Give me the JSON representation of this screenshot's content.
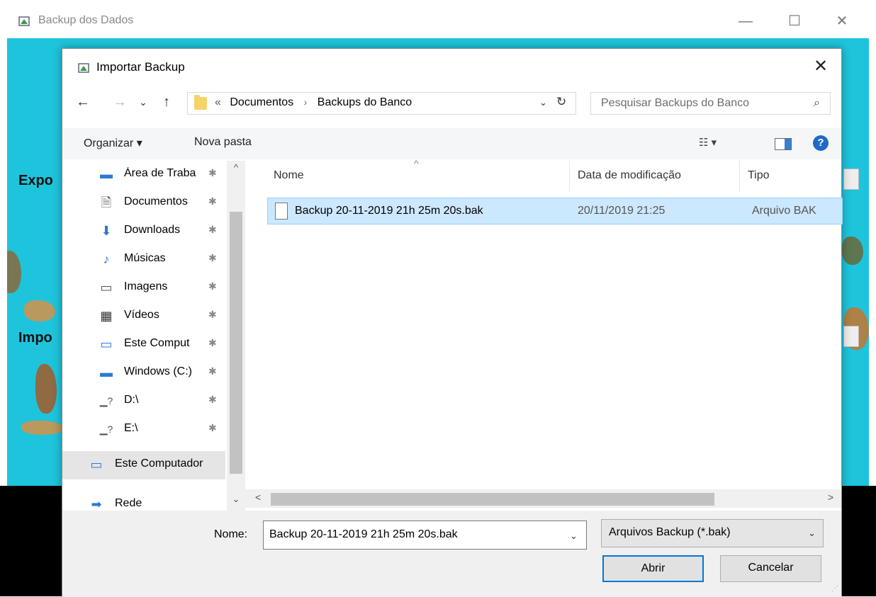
{
  "app": {
    "title": "Backup dos Dados",
    "side_labels": [
      "Expo",
      "Impo"
    ],
    "controls": {
      "minimize": "—",
      "maximize": "☐",
      "close": "✕"
    }
  },
  "dialog": {
    "title": "Importar Backup",
    "close": "✕",
    "nav": {
      "back": "←",
      "forward": "→",
      "recent": "⌄",
      "up": "↑"
    },
    "address": {
      "overflow": "«",
      "crumbs": [
        "Documentos",
        "Backups do Banco"
      ],
      "separator": "›",
      "dropdown": "⌄",
      "refresh": "↻"
    },
    "search": {
      "placeholder": "Pesquisar Backups do Banco",
      "icon": "⌕"
    },
    "toolbar": {
      "organize": "Organizar ▾",
      "new_folder": "Nova pasta",
      "view_icon": "☷ ▾",
      "help": "?"
    },
    "nav_pane": {
      "items": [
        {
          "label": "Área de Traba",
          "icon": "desktop-icon",
          "glyph": "▬",
          "color": "#2b7bd3",
          "pinned": true
        },
        {
          "label": "Documentos",
          "icon": "document-icon",
          "glyph": "🗎",
          "color": "#555555",
          "pinned": true
        },
        {
          "label": "Downloads",
          "icon": "download-icon",
          "glyph": "⬇",
          "color": "#2b7bd3",
          "pinned": true
        },
        {
          "label": "Músicas",
          "icon": "music-icon",
          "glyph": "♪",
          "color": "#2b7bd3",
          "pinned": true
        },
        {
          "label": "Imagens",
          "icon": "pictures-icon",
          "glyph": "▭",
          "color": "#555555",
          "pinned": true
        },
        {
          "label": "Vídeos",
          "icon": "video-icon",
          "glyph": "▦",
          "color": "#333333",
          "pinned": true
        },
        {
          "label": "Este Comput",
          "icon": "computer-icon",
          "glyph": "▭",
          "color": "#2b7bd3",
          "pinned": true
        },
        {
          "label": "Windows (C:)",
          "icon": "drive-icon",
          "glyph": "▬",
          "color": "#2b7bd3",
          "pinned": true
        },
        {
          "label": "D:\\",
          "icon": "drive-icon",
          "glyph": "▁?",
          "color": "#555555",
          "pinned": true
        },
        {
          "label": "E:\\",
          "icon": "drive-icon",
          "glyph": "▁?",
          "color": "#555555",
          "pinned": true
        }
      ],
      "selected": {
        "label": "Este Computador",
        "icon": "computer-icon"
      },
      "network": {
        "label": "Rede",
        "icon": "network-icon"
      },
      "pin_glyph": "📌"
    },
    "columns": [
      "Nome",
      "Data de modificação",
      "Tipo"
    ],
    "files": [
      {
        "name": "Backup 20-11-2019 21h 25m 20s.bak",
        "modified": "20/11/2019 21:25",
        "type": "Arquivo BAK"
      }
    ],
    "filename": {
      "label": "Nome:",
      "value": "Backup 20-11-2019 21h 25m 20s.bak",
      "dropdown": "⌄"
    },
    "filter": {
      "selected": "Arquivos Backup (*.bak)",
      "dropdown": "⌄"
    },
    "buttons": {
      "open": "Abrir",
      "cancel": "Cancelar"
    },
    "colors": {
      "selection": "#cce8ff",
      "accent": "#0078d7",
      "background": "#1ec4dc"
    }
  }
}
